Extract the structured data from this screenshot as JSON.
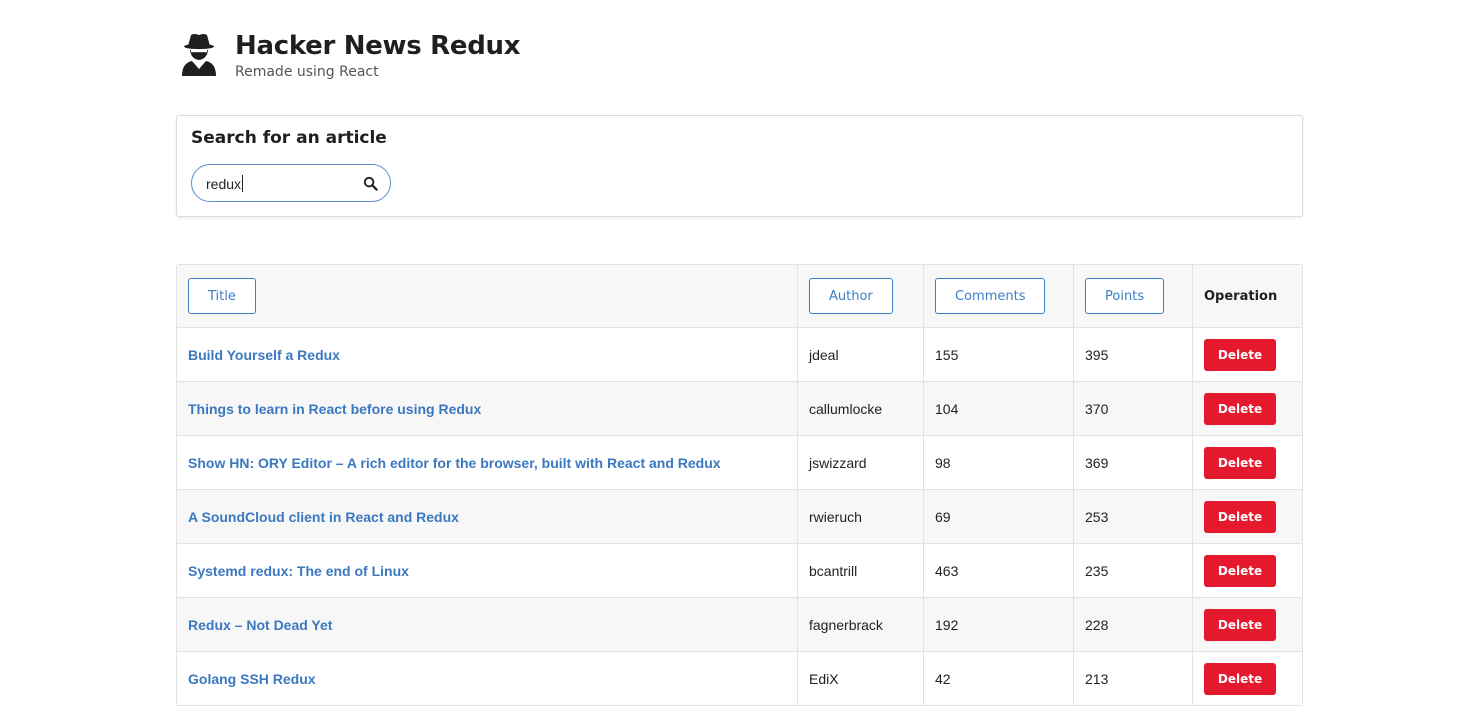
{
  "header": {
    "title": "Hacker News Redux",
    "subtitle": "Remade using React",
    "logo_icon": "spy-icon"
  },
  "search": {
    "heading": "Search for an article",
    "value": "redux",
    "icon": "search-icon"
  },
  "table": {
    "columns": {
      "title": "Title",
      "author": "Author",
      "comments": "Comments",
      "points": "Points",
      "operation": "Operation"
    },
    "delete_label": "Delete",
    "rows": [
      {
        "title": "Build Yourself a Redux",
        "author": "jdeal",
        "comments": "155",
        "points": "395"
      },
      {
        "title": "Things to learn in React before using Redux",
        "author": "callumlocke",
        "comments": "104",
        "points": "370"
      },
      {
        "title": "Show HN: ORY Editor – A rich editor for the browser, built with React and Redux",
        "author": "jswizzard",
        "comments": "98",
        "points": "369"
      },
      {
        "title": "A SoundCloud client in React and Redux",
        "author": "rwieruch",
        "comments": "69",
        "points": "253"
      },
      {
        "title": "Systemd redux: The end of Linux",
        "author": "bcantrill",
        "comments": "463",
        "points": "235"
      },
      {
        "title": "Redux – Not Dead Yet",
        "author": "fagnerbrack",
        "comments": "192",
        "points": "228"
      },
      {
        "title": "Golang SSH Redux",
        "author": "EdiX",
        "comments": "42",
        "points": "213"
      }
    ]
  },
  "colors": {
    "link": "#3a78c0",
    "delete": "#e5192e",
    "border": "#e2e2e2",
    "accent": "#3d7fc4"
  }
}
